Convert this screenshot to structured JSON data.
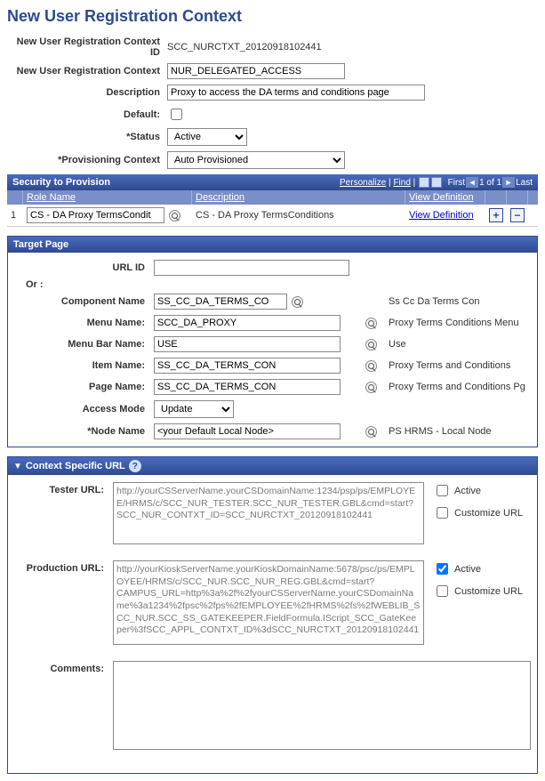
{
  "page_title": "New User Registration Context",
  "header_fields": {
    "context_id_label": "New User Registration Context ID",
    "context_id_value": "SCC_NURCTXT_20120918102441",
    "context_label": "New User Registration Context",
    "context_value": "NUR_DELEGATED_ACCESS",
    "description_label": "Description",
    "description_value": "Proxy to access the DA terms and conditions page",
    "default_label": "Default:",
    "default_checked": false,
    "status_label": "*Status",
    "status_value": "Active",
    "provisioning_label": "*Provisioning Context",
    "provisioning_value": "Auto Provisioned"
  },
  "security_grid": {
    "title": "Security to Provision",
    "personalize": "Personalize",
    "find": "Find",
    "nav_first": "First",
    "nav_count": "1 of 1",
    "nav_last": "Last",
    "columns": {
      "role_name": "Role Name",
      "description": "Description",
      "view_def": "View Definition"
    },
    "rows": [
      {
        "index": "1",
        "role_name": "CS - DA Proxy TermsCondit",
        "description": "CS - DA Proxy TermsConditions",
        "view_def": "View Definition"
      }
    ]
  },
  "target_page": {
    "title": "Target Page",
    "url_id_label": "URL ID",
    "url_id_value": "",
    "or_label": "Or :",
    "component_label": "Component Name",
    "component_value": "SS_CC_DA_TERMS_CO",
    "component_desc": "Ss Cc Da Terms Con",
    "menu_label": "Menu Name:",
    "menu_value": "SCC_DA_PROXY",
    "menu_desc": "Proxy Terms Conditions Menu",
    "menubar_label": "Menu Bar Name:",
    "menubar_value": "USE",
    "menubar_desc": "Use",
    "item_label": "Item Name:",
    "item_value": "SS_CC_DA_TERMS_CON",
    "item_desc": "Proxy Terms and Conditions",
    "page_label": "Page Name:",
    "page_value": "SS_CC_DA_TERMS_CON",
    "page_desc": "Proxy Terms and Conditions Pg",
    "access_label": "Access Mode",
    "access_value": "Update",
    "node_label": "*Node Name",
    "node_value": "<your Default Local Node>",
    "node_desc": "PS HRMS - Local Node"
  },
  "context_url": {
    "title": "Context Specific URL",
    "tester_label": "Tester URL:",
    "tester_value": "http://yourCSServerName.yourCSDomainName:1234/psp/ps/EMPLOYEE/HRMS/c/SCC_NUR_TESTER.SCC_NUR_TESTER.GBL&cmd=start?SCC_NUR_CONTXT_ID=SCC_NURCTXT_20120918102441",
    "tester_active": false,
    "tester_customize": false,
    "production_label": "Production URL:",
    "production_value": "http://yourKioskServerName.yourKioskDomainName:5678/psc/ps/EMPLOYEE/HRMS/c/SCC_NUR.SCC_NUR_REG.GBL&cmd=start?CAMPUS_URL=http%3a%2f%2fyourCSServerName.yourCSDomainName%3a1234%2fpsc%2fps%2fEMPLOYEE%2fHRMS%2fs%2fWEBLIB_SCC_NUR.SCC_SS_GATEKEEPER.FieldFormula.IScript_SCC_GateKeeper%3fSCC_APPL_CONTXT_ID%3dSCC_NURCTXT_20120918102441",
    "production_active": true,
    "production_customize": false,
    "active_label": "Active",
    "customize_label": "Customize URL",
    "comments_label": "Comments:",
    "comments_value": ""
  }
}
